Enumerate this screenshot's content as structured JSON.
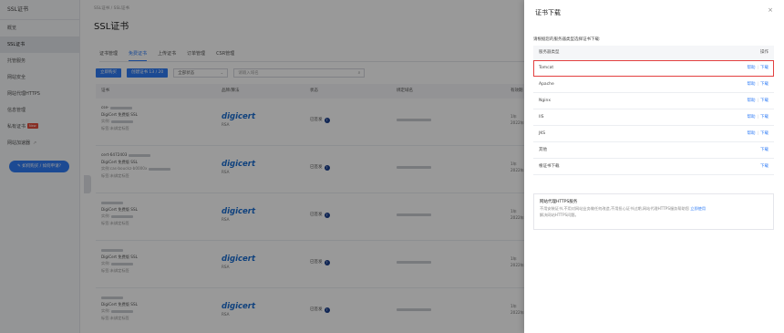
{
  "sidebar": {
    "title": "SSL证书",
    "items": [
      {
        "label": "概览",
        "active": false
      },
      {
        "label": "SSL证书",
        "active": true
      },
      {
        "label": "托管服务",
        "active": false
      },
      {
        "label": "网站安全",
        "active": false
      },
      {
        "label": "网站代理HTTPS",
        "active": false
      },
      {
        "label": "信息管理",
        "active": false
      },
      {
        "label": "私有证书",
        "badge": "New",
        "active": false
      },
      {
        "label": "网站加速器",
        "external_icon": "external-link-icon",
        "active": false
      }
    ],
    "help_button": "如何购买 / 如何申请?"
  },
  "main": {
    "breadcrumb": "SSL证书 / SSL证书",
    "title": "SSL证书",
    "tabs": [
      "证书管理",
      "免费证书",
      "上传证书",
      "订单管理",
      "CSR管理"
    ],
    "active_tab": 1,
    "toolbar": {
      "apply_btn": "立即购买",
      "create_btn": "创建证书 13 / 20",
      "status_select": "全部状态",
      "search_placeholder": "请输入域名"
    },
    "columns": [
      "证书",
      "品牌/算法",
      "状态",
      "绑定域名",
      "有效期"
    ],
    "rows": [
      {
        "line1": "cse-",
        "line2": "DigiCert 免费版 SSL",
        "line3": "实例:",
        "line4": "标签:未绑定标签",
        "brand": "digicert",
        "algo": "RSA",
        "status": "已签发",
        "expire_a": "1年",
        "expire_b": "2022年"
      },
      {
        "line1": "cert-6472403",
        "line2": "DigiCert 免费版 SSL",
        "line3": "实例:cas-bouckz-b0000x",
        "line4": "标签:未绑定标签",
        "brand": "digicert",
        "algo": "RSA",
        "status": "已签发",
        "expire_a": "1年",
        "expire_b": "2022年"
      },
      {
        "line1": "",
        "line2": "DigiCert 免费版 SSL",
        "line3": "实例:",
        "line4": "标签:未绑定标签",
        "brand": "digicert",
        "algo": "RSA",
        "status": "已签发",
        "expire_a": "1年",
        "expire_b": "2022年"
      },
      {
        "line1": "",
        "line2": "DigiCert 免费版 SSL",
        "line3": "实例:",
        "line4": "标签:未绑定标签",
        "brand": "digicert",
        "algo": "RSA",
        "status": "已签发",
        "expire_a": "1年",
        "expire_b": "2022年"
      },
      {
        "line1": "",
        "line2": "DigiCert 免费版 SSL",
        "line3": "实例:",
        "line4": "标签:未绑定标签",
        "brand": "digicert",
        "algo": "RSA",
        "status": "已签发",
        "expire_a": "1年",
        "expire_b": "2022年"
      }
    ]
  },
  "drawer": {
    "title": "证书下载",
    "close": "×",
    "tip": "请根据您的服务器类型选择证书下载:",
    "col_server": "服务器类型",
    "col_action": "操作",
    "help_label": "帮助",
    "download_label": "下载",
    "rows": [
      {
        "server": "Tomcat",
        "has_help": true,
        "highlighted": true
      },
      {
        "server": "Apache",
        "has_help": true,
        "highlighted": false
      },
      {
        "server": "Nginx",
        "has_help": true,
        "highlighted": false
      },
      {
        "server": "IIS",
        "has_help": true,
        "highlighted": false
      },
      {
        "server": "JKS",
        "has_help": true,
        "highlighted": false
      },
      {
        "server": "其他",
        "has_help": false,
        "highlighted": false
      },
      {
        "server": "根证书下载",
        "has_help": false,
        "highlighted": false
      }
    ],
    "note_title": "网站代理HTTPS服务",
    "note_body": "不用安装证书,不用对网站业务做任何改造,不用担心证书过期,网站代理HTTPS服务帮助您",
    "note_link": "立即使用",
    "note_body2": "解决网站HTTPS问题。"
  },
  "colors": {
    "accent": "#2f7cf6",
    "highlight": "#e34040",
    "digicert": "#1a6dd1"
  }
}
